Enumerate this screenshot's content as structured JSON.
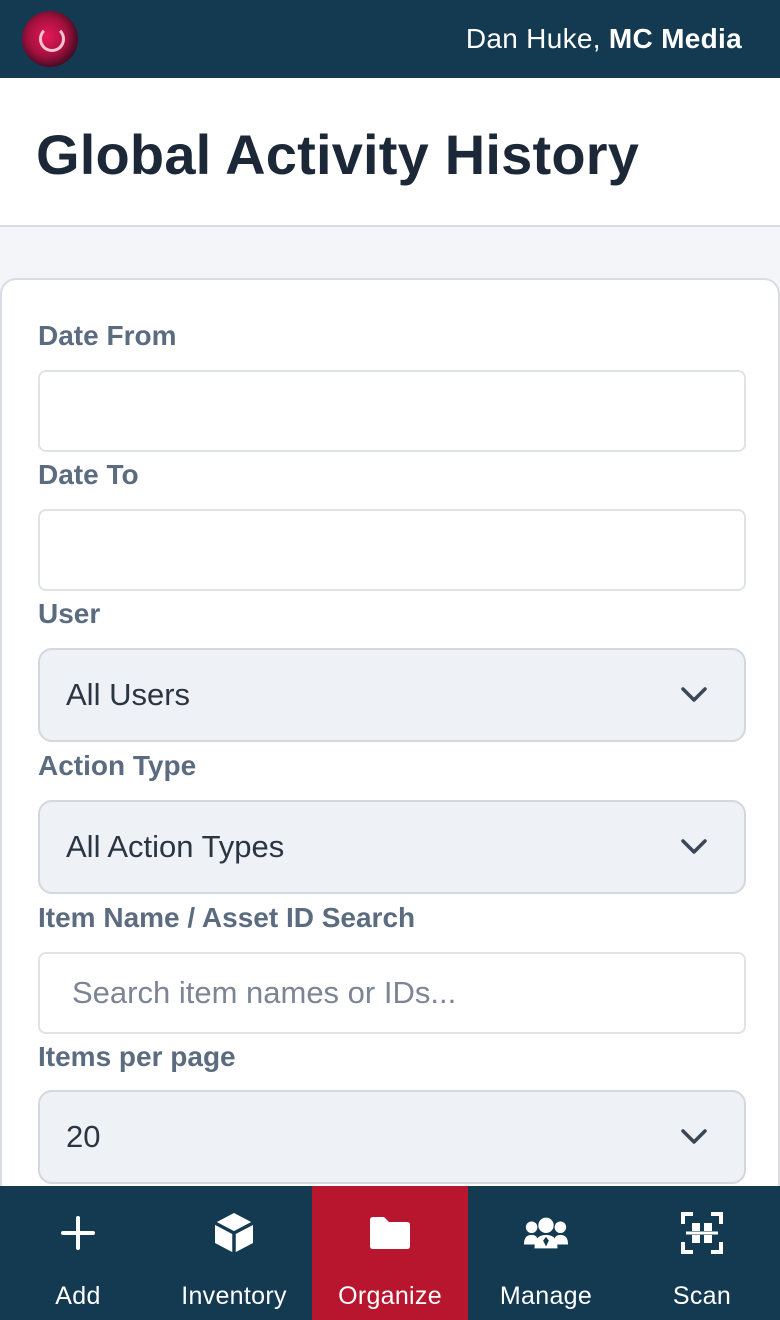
{
  "header": {
    "user_name": "Dan Huke,",
    "org_name": "MC Media"
  },
  "page": {
    "title": "Global Activity History"
  },
  "filters": {
    "date_from_label": "Date From",
    "date_from_value": "",
    "date_to_label": "Date To",
    "date_to_value": "",
    "user_label": "User",
    "user_selected": "All Users",
    "action_type_label": "Action Type",
    "action_type_selected": "All Action Types",
    "search_label": "Item Name / Asset ID Search",
    "search_placeholder": "Search item names or IDs...",
    "search_value": "",
    "per_page_label": "Items per page",
    "per_page_selected": "20"
  },
  "bottom_nav": {
    "items": [
      {
        "label": "Add",
        "icon": "plus-icon",
        "active": false
      },
      {
        "label": "Inventory",
        "icon": "box-icon",
        "active": false
      },
      {
        "label": "Organize",
        "icon": "folder-icon",
        "active": true
      },
      {
        "label": "Manage",
        "icon": "users-icon",
        "active": false
      },
      {
        "label": "Scan",
        "icon": "scan-icon",
        "active": false
      }
    ],
    "active_color": "#b8152f",
    "bar_color": "#143a52"
  },
  "colors": {
    "header_bg": "#143a52",
    "accent": "#b8152f"
  }
}
